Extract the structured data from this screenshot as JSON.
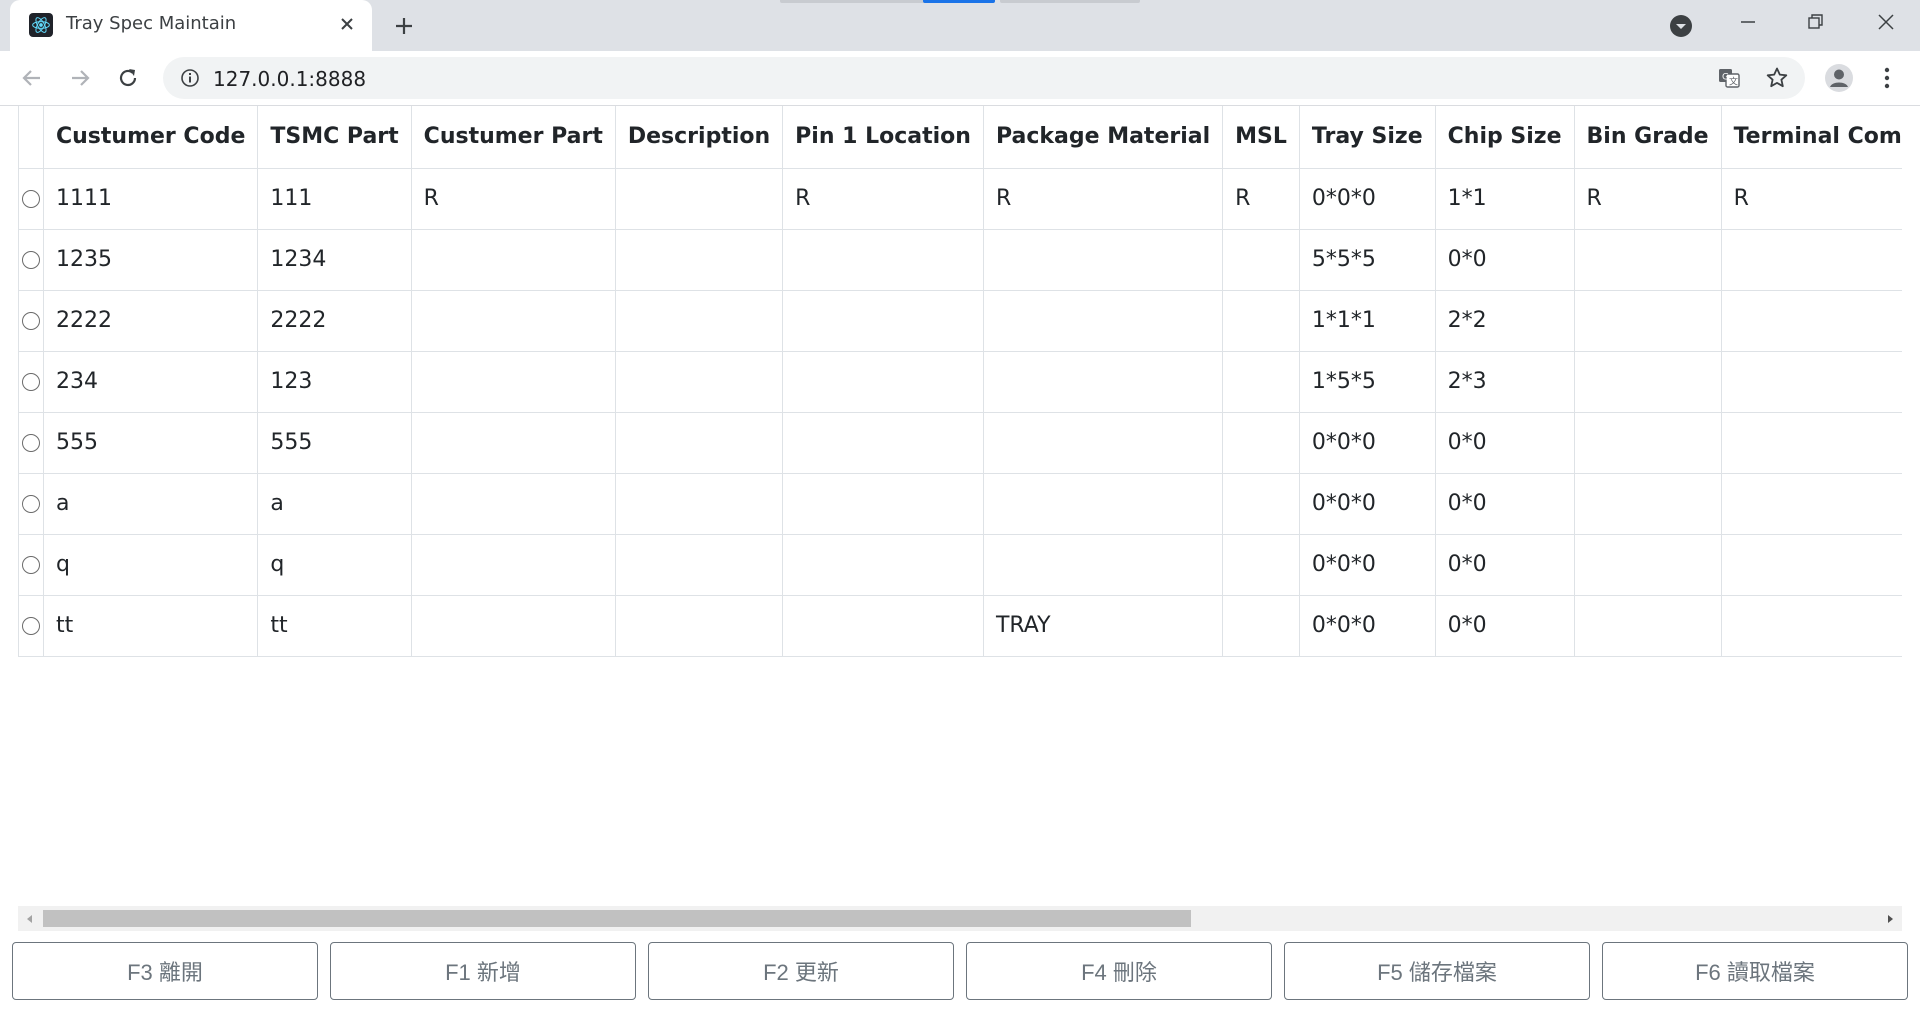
{
  "browser": {
    "tab_title": "Tray Spec Maintain",
    "url": "127.0.0.1:8888",
    "colors": {
      "tab_bar": "#dee1e6",
      "tab_indicator": "#1a73e8",
      "omnibox": "#f1f3f4"
    }
  },
  "table": {
    "columns": [
      "",
      "Custumer Code",
      "TSMC Part",
      "Custumer Part",
      "Description",
      "Pin 1 Location",
      "Package Material",
      "MSL",
      "Tray Size",
      "Chip Size",
      "Bin Grade",
      "Terminal Composition",
      ""
    ],
    "rows": [
      [
        "",
        "1111",
        "111",
        "R",
        "",
        "R",
        "R",
        "R",
        "0*0*0",
        "1*1",
        "R",
        "R",
        ""
      ],
      [
        "",
        "1235",
        "1234",
        "",
        "",
        "",
        "",
        "",
        "5*5*5",
        "0*0",
        "",
        "",
        ""
      ],
      [
        "",
        "2222",
        "2222",
        "",
        "",
        "",
        "",
        "",
        "1*1*1",
        "2*2",
        "",
        "",
        ""
      ],
      [
        "",
        "234",
        "123",
        "",
        "",
        "",
        "",
        "",
        "1*5*5",
        "2*3",
        "",
        "",
        ""
      ],
      [
        "",
        "555",
        "555",
        "",
        "",
        "",
        "",
        "",
        "0*0*0",
        "0*0",
        "",
        "",
        ""
      ],
      [
        "",
        "a",
        "a",
        "",
        "",
        "",
        "",
        "",
        "0*0*0",
        "0*0",
        "",
        "",
        ""
      ],
      [
        "",
        "q",
        "q",
        "",
        "",
        "",
        "",
        "",
        "0*0*0",
        "0*0",
        "",
        "",
        ""
      ],
      [
        "",
        "tt",
        "tt",
        "",
        "",
        "",
        "TRAY",
        "",
        "0*0*0",
        "0*0",
        "",
        "",
        ""
      ]
    ],
    "selected_row": null
  },
  "actions": {
    "exit": "F3 離開",
    "add": "F1 新增",
    "update": "F2 更新",
    "delete": "F4 刪除",
    "save_file": "F5 儲存檔案",
    "load_file": "F6 讀取檔案"
  },
  "colors": {
    "button_text": "#6c757d",
    "button_border": "#6c757d",
    "grid_border": "#dee2e6",
    "scroll_thumb": "#c1c1c1",
    "scroll_track": "#f1f1f1"
  }
}
